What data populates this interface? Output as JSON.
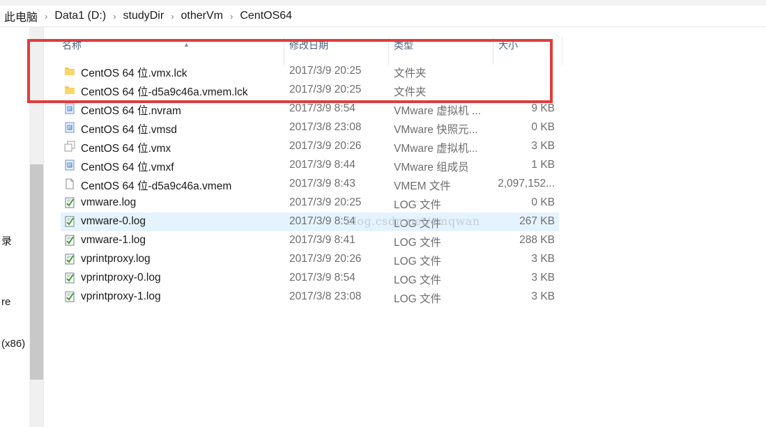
{
  "breadcrumb": [
    "此电脑",
    "Data1 (D:)",
    "studyDir",
    "otherVm",
    "CentOS64"
  ],
  "nav": {
    "items": [
      {
        "label": "录"
      },
      {
        "label": "re"
      },
      {
        "label": "(x86)"
      }
    ]
  },
  "columns": {
    "name": "名称",
    "date": "修改日期",
    "type": "类型",
    "size": "大小"
  },
  "files": [
    {
      "name": "CentOS 64 位.vmx.lck",
      "date": "2017/3/9 20:25",
      "type": "文件夹",
      "size": "",
      "icon": "folder-icon"
    },
    {
      "name": "CentOS 64 位-d5a9c46a.vmem.lck",
      "date": "2017/3/9 20:25",
      "type": "文件夹",
      "size": "",
      "icon": "folder-icon"
    },
    {
      "name": "CentOS 64 位.nvram",
      "date": "2017/3/9 8:54",
      "type": "VMware 虚拟机 ...",
      "size": "9 KB",
      "icon": "vmware-file-icon"
    },
    {
      "name": "CentOS 64 位.vmsd",
      "date": "2017/3/8 23:08",
      "type": "VMware 快照元...",
      "size": "0 KB",
      "icon": "vmware-file-icon"
    },
    {
      "name": "CentOS 64 位.vmx",
      "date": "2017/3/9 20:26",
      "type": "VMware 虚拟机...",
      "size": "3 KB",
      "icon": "vmx-file-icon"
    },
    {
      "name": "CentOS 64 位.vmxf",
      "date": "2017/3/9 8:44",
      "type": "VMware 组成员",
      "size": "1 KB",
      "icon": "vmware-file-icon"
    },
    {
      "name": "CentOS 64 位-d5a9c46a.vmem",
      "date": "2017/3/9 8:43",
      "type": "VMEM 文件",
      "size": "2,097,152...",
      "icon": "blank-file-icon"
    },
    {
      "name": "vmware.log",
      "date": "2017/3/9 20:25",
      "type": "LOG 文件",
      "size": "0 KB",
      "icon": "log-file-icon"
    },
    {
      "name": "vmware-0.log",
      "date": "2017/3/9 8:54",
      "type": "LOG 文件",
      "size": "267 KB",
      "icon": "log-file-icon",
      "selected": true
    },
    {
      "name": "vmware-1.log",
      "date": "2017/3/9 8:41",
      "type": "LOG 文件",
      "size": "288 KB",
      "icon": "log-file-icon"
    },
    {
      "name": "vprintproxy.log",
      "date": "2017/3/9 20:26",
      "type": "LOG 文件",
      "size": "3 KB",
      "icon": "log-file-icon"
    },
    {
      "name": "vprintproxy-0.log",
      "date": "2017/3/9 8:54",
      "type": "LOG 文件",
      "size": "3 KB",
      "icon": "log-file-icon"
    },
    {
      "name": "vprintproxy-1.log",
      "date": "2017/3/8 23:08",
      "type": "LOG 文件",
      "size": "3 KB",
      "icon": "log-file-icon"
    }
  ],
  "watermark": "blog.csdn.net/cmqwan",
  "colors": {
    "highlight_box": "#e03c3c",
    "selected_row": "#e5f3ff",
    "folder": "#f7c948"
  }
}
